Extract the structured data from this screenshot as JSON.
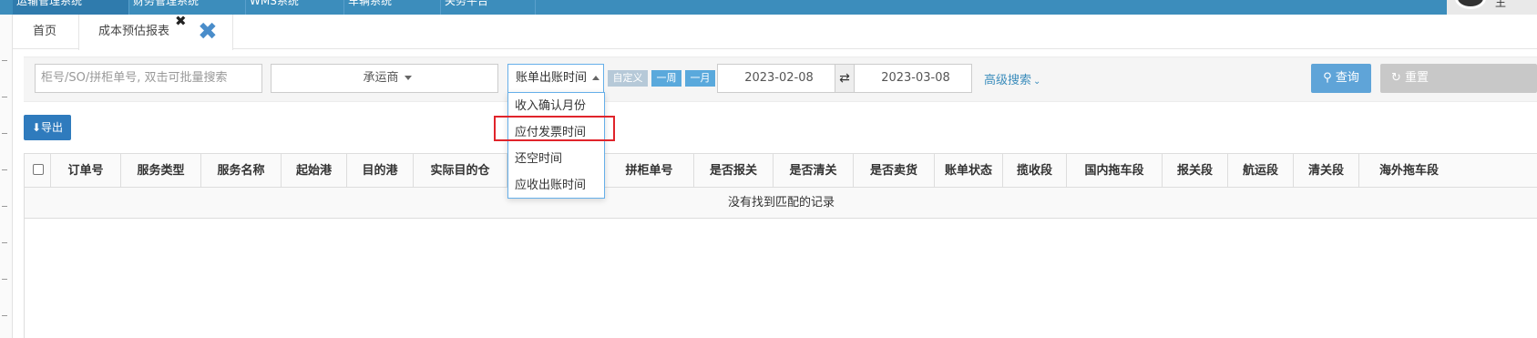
{
  "topnav": {
    "items": [
      "运输管理系统",
      "财务管理系统",
      "WMS系统",
      "车辆系统",
      "关务平台"
    ],
    "user": "王"
  },
  "tabs": {
    "home": "首页",
    "current": "成本预估报表",
    "close_small": "✖",
    "close_big": "✖"
  },
  "filters": {
    "search_placeholder": "柜号/SO/拼柜单号, 双击可批量搜索",
    "carrier": "承运商",
    "date_type": "账单出账时间",
    "quick_custom": "自定义",
    "quick_week": "一周",
    "quick_month": "一月",
    "date_start": "2023-02-08",
    "date_end": "2023-03-08",
    "swap_icon": "⇄",
    "advanced": "高级搜索",
    "query": "查询",
    "reset": "重置"
  },
  "toolbar": {
    "export": "导出"
  },
  "dropdown": {
    "items": [
      "收入确认月份",
      "应付发票时间",
      "还空时间",
      "应收出账时间"
    ],
    "highlighted": "应付发票时间"
  },
  "table": {
    "columns": [
      "订单号",
      "服务类型",
      "服务名称",
      "起始港",
      "目的港",
      "实际目的仓",
      "",
      "拼柜单号",
      "是否报关",
      "是否清关",
      "是否卖货",
      "账单状态",
      "揽收段",
      "国内拖车段",
      "报关段",
      "航运段",
      "清关段",
      "海外拖车段"
    ],
    "empty_message": "没有找到匹配的记录"
  },
  "colors": {
    "accent": "#3c8dbc",
    "highlight": "#e0242b",
    "query": "#5fa4d8"
  }
}
